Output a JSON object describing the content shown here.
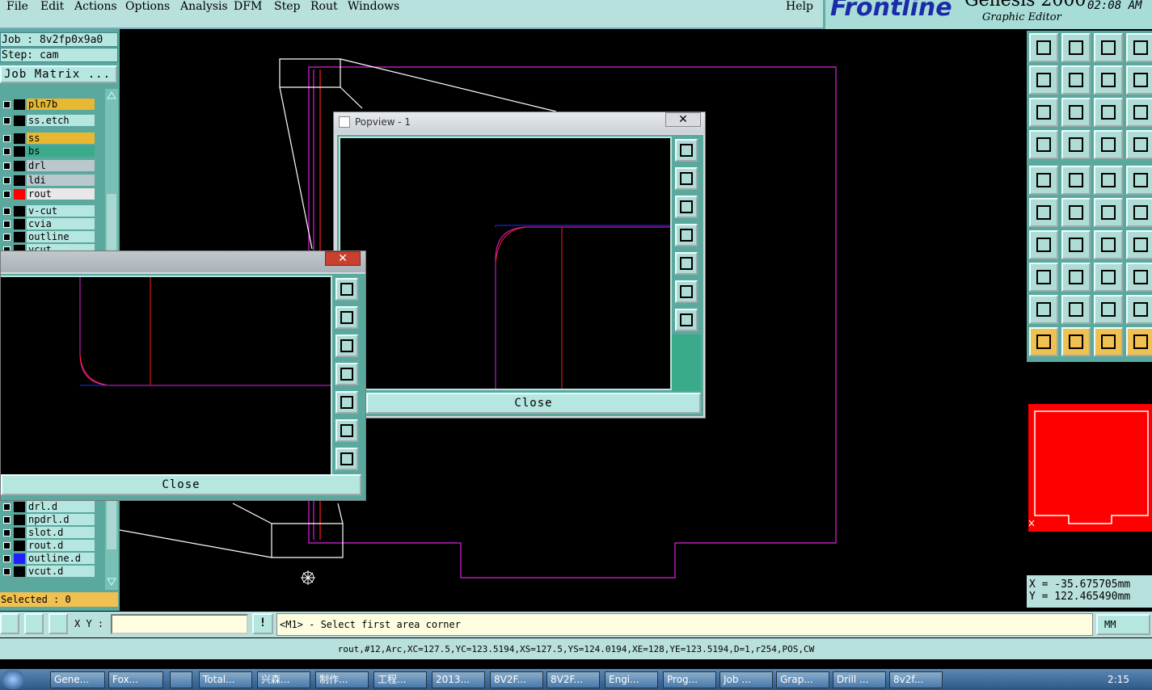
{
  "menubar": {
    "items": [
      "File",
      "Edit",
      "Actions",
      "Options",
      "Analysis",
      "DFM",
      "Step",
      "Rout",
      "Windows"
    ],
    "help": "Help"
  },
  "brand": {
    "logo": "Frontline",
    "product": "Genesis 2000",
    "subtitle": "Graphic Editor",
    "clock": "02:08 AM"
  },
  "job": {
    "job_label": "Job : 8v2fp0x9a0",
    "step_label": "Step: cam",
    "matrix_button": "Job Matrix ..."
  },
  "layers_top": [
    {
      "name": "pln7b",
      "color": "#e8b830",
      "swatch": "#000"
    },
    {
      "name": "ss.etch",
      "color": "#b6e6e0",
      "swatch": "#000"
    },
    {
      "name": "ss",
      "color": "#e8b830",
      "swatch": "#000"
    },
    {
      "name": "bs",
      "color": "#3aaa8a",
      "swatch": "#000"
    },
    {
      "name": "drl",
      "color": "#b8c8cc",
      "swatch": "#000"
    },
    {
      "name": "ldi",
      "color": "#b8c8cc",
      "swatch": "#000"
    },
    {
      "name": "rout",
      "color": "#e8e8e8",
      "swatch": "#ff0000"
    },
    {
      "name": "v-cut",
      "color": "#b6e6e0",
      "swatch": "#000"
    },
    {
      "name": "cvia",
      "color": "#b6e6e0",
      "swatch": "#000"
    },
    {
      "name": "outline",
      "color": "#b6e6e0",
      "swatch": "#000"
    },
    {
      "name": "vcut",
      "color": "#b6e6e0",
      "swatch": "#000"
    }
  ],
  "layers_bottom": [
    {
      "name": "drl.d",
      "color": "#b6e6e0",
      "swatch": "#000"
    },
    {
      "name": "npdrl.d",
      "color": "#b6e6e0",
      "swatch": "#000"
    },
    {
      "name": "slot.d",
      "color": "#b6e6e0",
      "swatch": "#000"
    },
    {
      "name": "rout.d",
      "color": "#b6e6e0",
      "swatch": "#000"
    },
    {
      "name": "outline.d",
      "color": "#b6e6e0",
      "swatch": "#2020ff"
    },
    {
      "name": "vcut.d",
      "color": "#b6e6e0",
      "swatch": "#000"
    }
  ],
  "selected": "Selected : 0",
  "popview1": {
    "title": "Popview - 1",
    "close_label": "Close"
  },
  "popview2": {
    "title": "",
    "close_label": "Close"
  },
  "command": {
    "xy_label": "X Y :",
    "xy_value": "",
    "prompt": "<M1> - Select first area corner",
    "units": "MM"
  },
  "status": "rout,#12,Arc,XC=127.5,YC=123.5194,XS=127.5,YS=124.0194,XE=128,YE=123.5194,D=1,r254,POS,CW",
  "coords": {
    "x": "X = -35.675705mm",
    "y": "Y = 122.465490mm"
  },
  "taskbar": {
    "items": [
      "Gene...",
      "Fox...",
      "",
      "Total...",
      "兴森...",
      "制作...",
      "工程...",
      "2013...",
      "8V2F...",
      "8V2F...",
      "Engi...",
      "Prog...",
      "Job ...",
      "Grap...",
      "Drill ...",
      "8v2f..."
    ],
    "time": "2:15"
  }
}
